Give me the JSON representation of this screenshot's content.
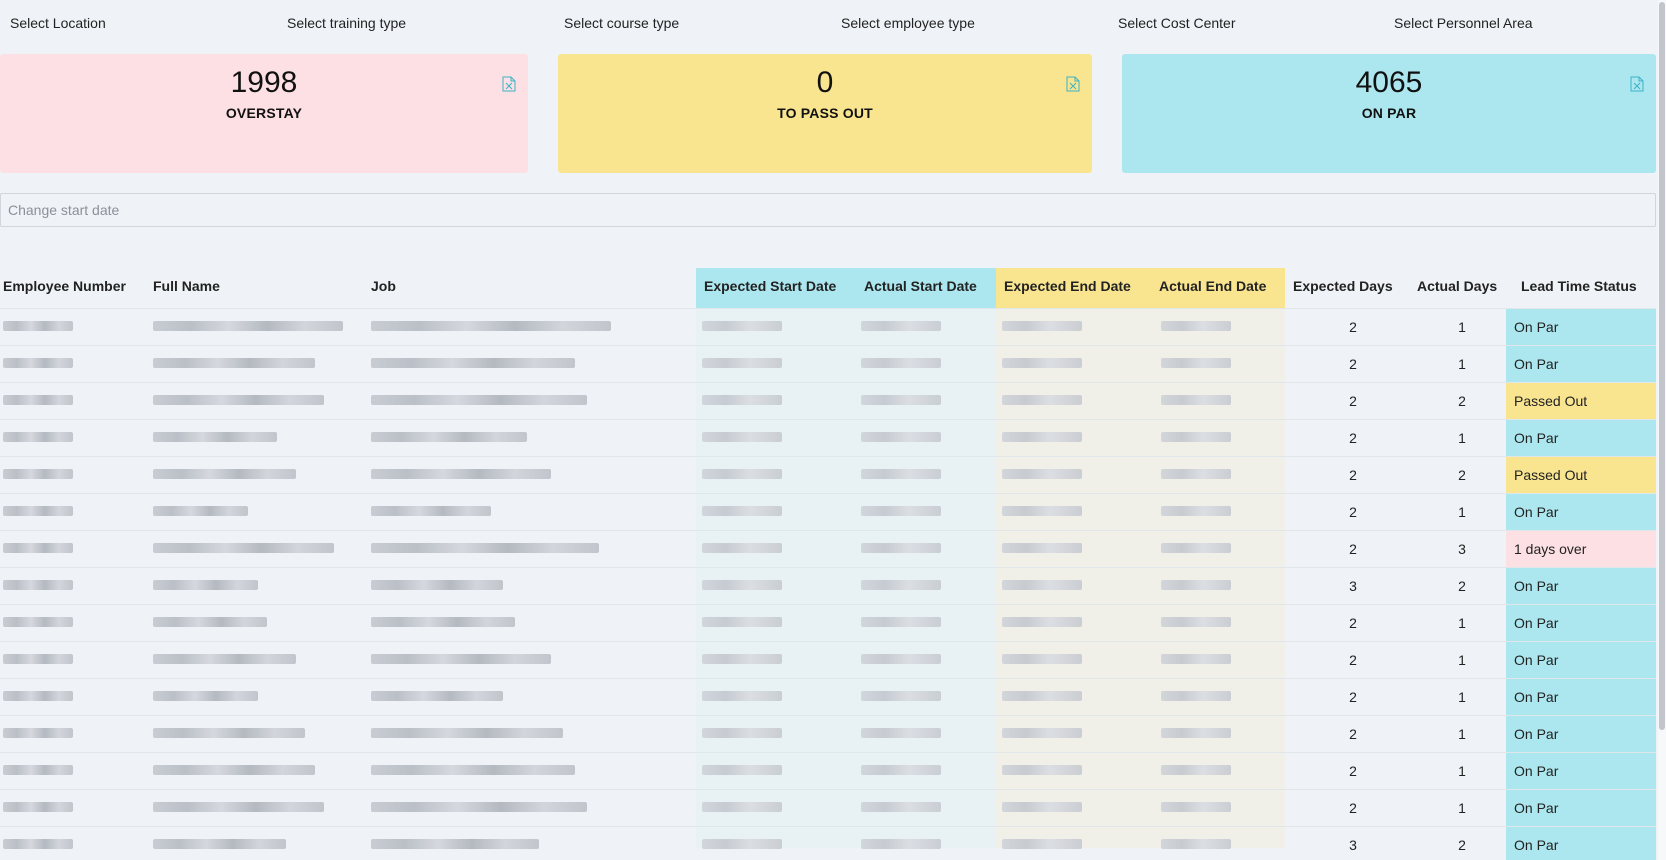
{
  "filters": [
    {
      "label": "Select Location"
    },
    {
      "label": "Select training type"
    },
    {
      "label": "Select course type"
    },
    {
      "label": "Select employee type"
    },
    {
      "label": "Select Cost Center"
    },
    {
      "label": "Select Personnel Area"
    }
  ],
  "cards": {
    "overstay": {
      "count": "1998",
      "label": "OVERSTAY",
      "color": "#fde0e3"
    },
    "pass_out": {
      "count": "0",
      "label": "TO PASS OUT",
      "color": "#f9e590"
    },
    "on_par": {
      "count": "4065",
      "label": "ON PAR",
      "color": "#ace7ef"
    },
    "export_icon": "excel-file-icon"
  },
  "date_input": {
    "placeholder": "Change start date",
    "value": ""
  },
  "table": {
    "columns": [
      "Employee Number",
      "Full Name",
      "Job",
      "Expected Start Date",
      "Actual Start Date",
      "Expected End Date",
      "Actual End Date",
      "Expected Days",
      "Actual Days",
      "Lead Time Status"
    ],
    "rows": [
      {
        "expected_days": "2",
        "actual_days": "1",
        "status": "On Par",
        "status_type": "on-par"
      },
      {
        "expected_days": "2",
        "actual_days": "1",
        "status": "On Par",
        "status_type": "on-par"
      },
      {
        "expected_days": "2",
        "actual_days": "2",
        "status": "Passed Out",
        "status_type": "passed-out"
      },
      {
        "expected_days": "2",
        "actual_days": "1",
        "status": "On Par",
        "status_type": "on-par"
      },
      {
        "expected_days": "2",
        "actual_days": "2",
        "status": "Passed Out",
        "status_type": "passed-out"
      },
      {
        "expected_days": "2",
        "actual_days": "1",
        "status": "On Par",
        "status_type": "on-par"
      },
      {
        "expected_days": "2",
        "actual_days": "3",
        "status": "1 days over",
        "status_type": "overstay"
      },
      {
        "expected_days": "3",
        "actual_days": "2",
        "status": "On Par",
        "status_type": "on-par"
      },
      {
        "expected_days": "2",
        "actual_days": "1",
        "status": "On Par",
        "status_type": "on-par"
      },
      {
        "expected_days": "2",
        "actual_days": "1",
        "status": "On Par",
        "status_type": "on-par"
      },
      {
        "expected_days": "2",
        "actual_days": "1",
        "status": "On Par",
        "status_type": "on-par"
      },
      {
        "expected_days": "2",
        "actual_days": "1",
        "status": "On Par",
        "status_type": "on-par"
      },
      {
        "expected_days": "2",
        "actual_days": "1",
        "status": "On Par",
        "status_type": "on-par"
      },
      {
        "expected_days": "2",
        "actual_days": "1",
        "status": "On Par",
        "status_type": "on-par"
      },
      {
        "expected_days": "3",
        "actual_days": "2",
        "status": "On Par",
        "status_type": "on-par"
      }
    ]
  }
}
